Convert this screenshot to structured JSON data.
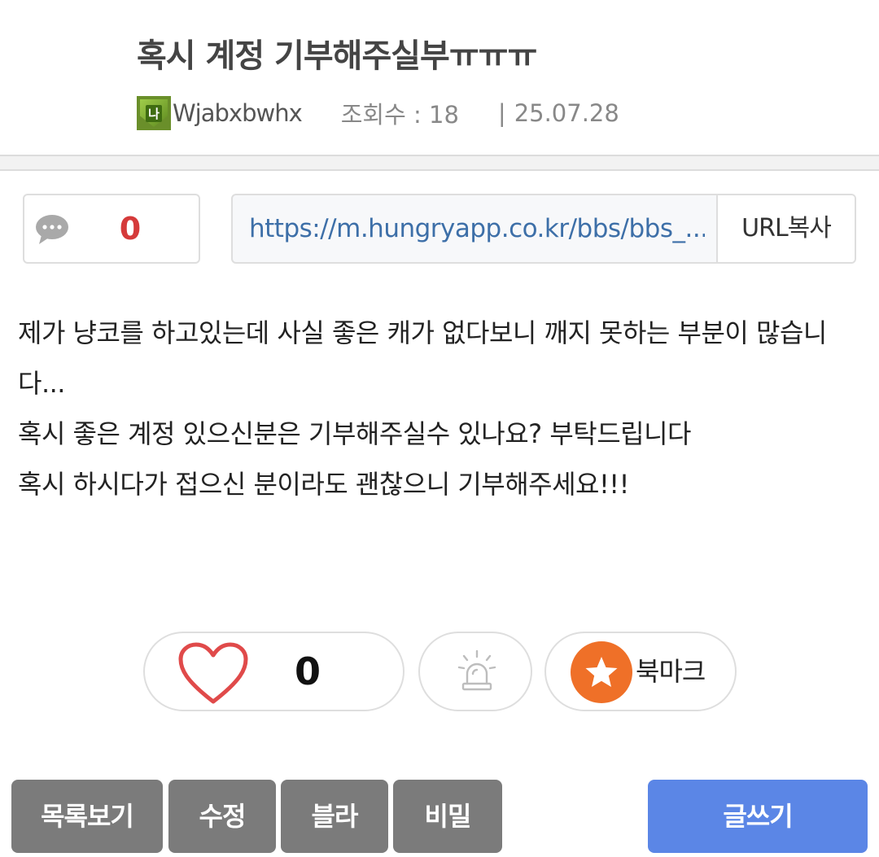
{
  "post": {
    "title": "혹시 계정 기부해주실부ㅠㅠㅠ",
    "level_badge": "나",
    "author": "Wjabxbwhx",
    "views_label": "조회수 : 18",
    "separator": "|",
    "date": "25.07.28"
  },
  "comments": {
    "count": "0"
  },
  "share": {
    "url": "https://m.hungryapp.co.kr/bbs/bbs_...",
    "copy_label": "URL복사"
  },
  "content": {
    "lines": [
      "제가 냥코를 하고있는데 사실 좋은 캐가 없다보니 깨지 못하는 부분이 많습니다...",
      "혹시 좋은 계정 있으신분은 기부해주실수 있나요? 부탁드립니다",
      "혹시 하시다가 접으신 분이라도 괜찮으니 기부해주세요!!!"
    ]
  },
  "reactions": {
    "like_count": "0",
    "bookmark_label": "북마크"
  },
  "actions": {
    "list": "목록보기",
    "edit": "수정",
    "blur": "블라",
    "secret": "비밀",
    "write": "글쓰기"
  },
  "icons": {
    "comment": "speech-bubble-icon",
    "like": "heart-icon",
    "report": "siren-icon",
    "bookmark": "star-icon"
  },
  "colors": {
    "comment_count": "#d53a3a",
    "url": "#3d6fa8",
    "bookmark_accent": "#ef7028",
    "heart": "#e04a4a",
    "write_button": "#5b86e6",
    "gray_button": "#7b7b7b"
  }
}
